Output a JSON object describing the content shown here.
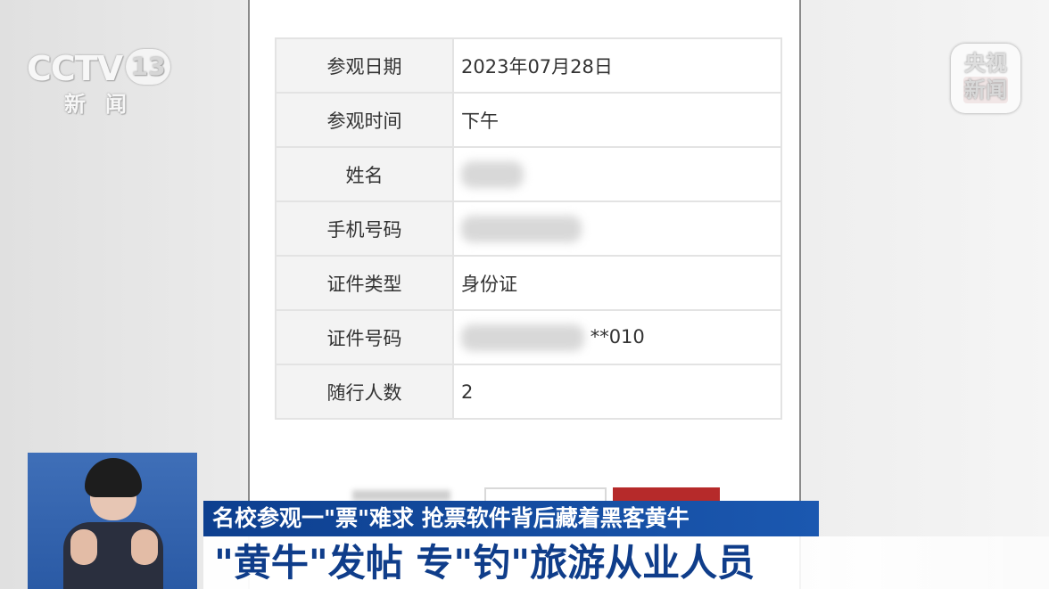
{
  "form": {
    "rows": [
      {
        "label": "参观日期",
        "value": "2023年07月28日"
      },
      {
        "label": "参观时间",
        "value": "下午"
      },
      {
        "label": "姓名",
        "value": ""
      },
      {
        "label": "手机号码",
        "value": ""
      },
      {
        "label": "证件类型",
        "value": "身份证"
      },
      {
        "label": "证件号码",
        "value": "**010"
      },
      {
        "label": "随行人数",
        "value": "2"
      }
    ]
  },
  "logo": {
    "cctv_text": "CCTV",
    "channel": "13",
    "subtitle": "新闻",
    "yangshi_line1": "央视",
    "yangshi_line2": "新闻"
  },
  "caption": {
    "top": "名校参观一\"票\"难求 抢票软件背后藏着黑客黄牛",
    "bottom": "\"黄牛\"发帖 专\"钓\"旅游从业人员"
  },
  "colors": {
    "caption_top_bg": "#1b58b0",
    "caption_bottom_text": "#0f3d8a",
    "submit_button": "#b62a2a"
  }
}
